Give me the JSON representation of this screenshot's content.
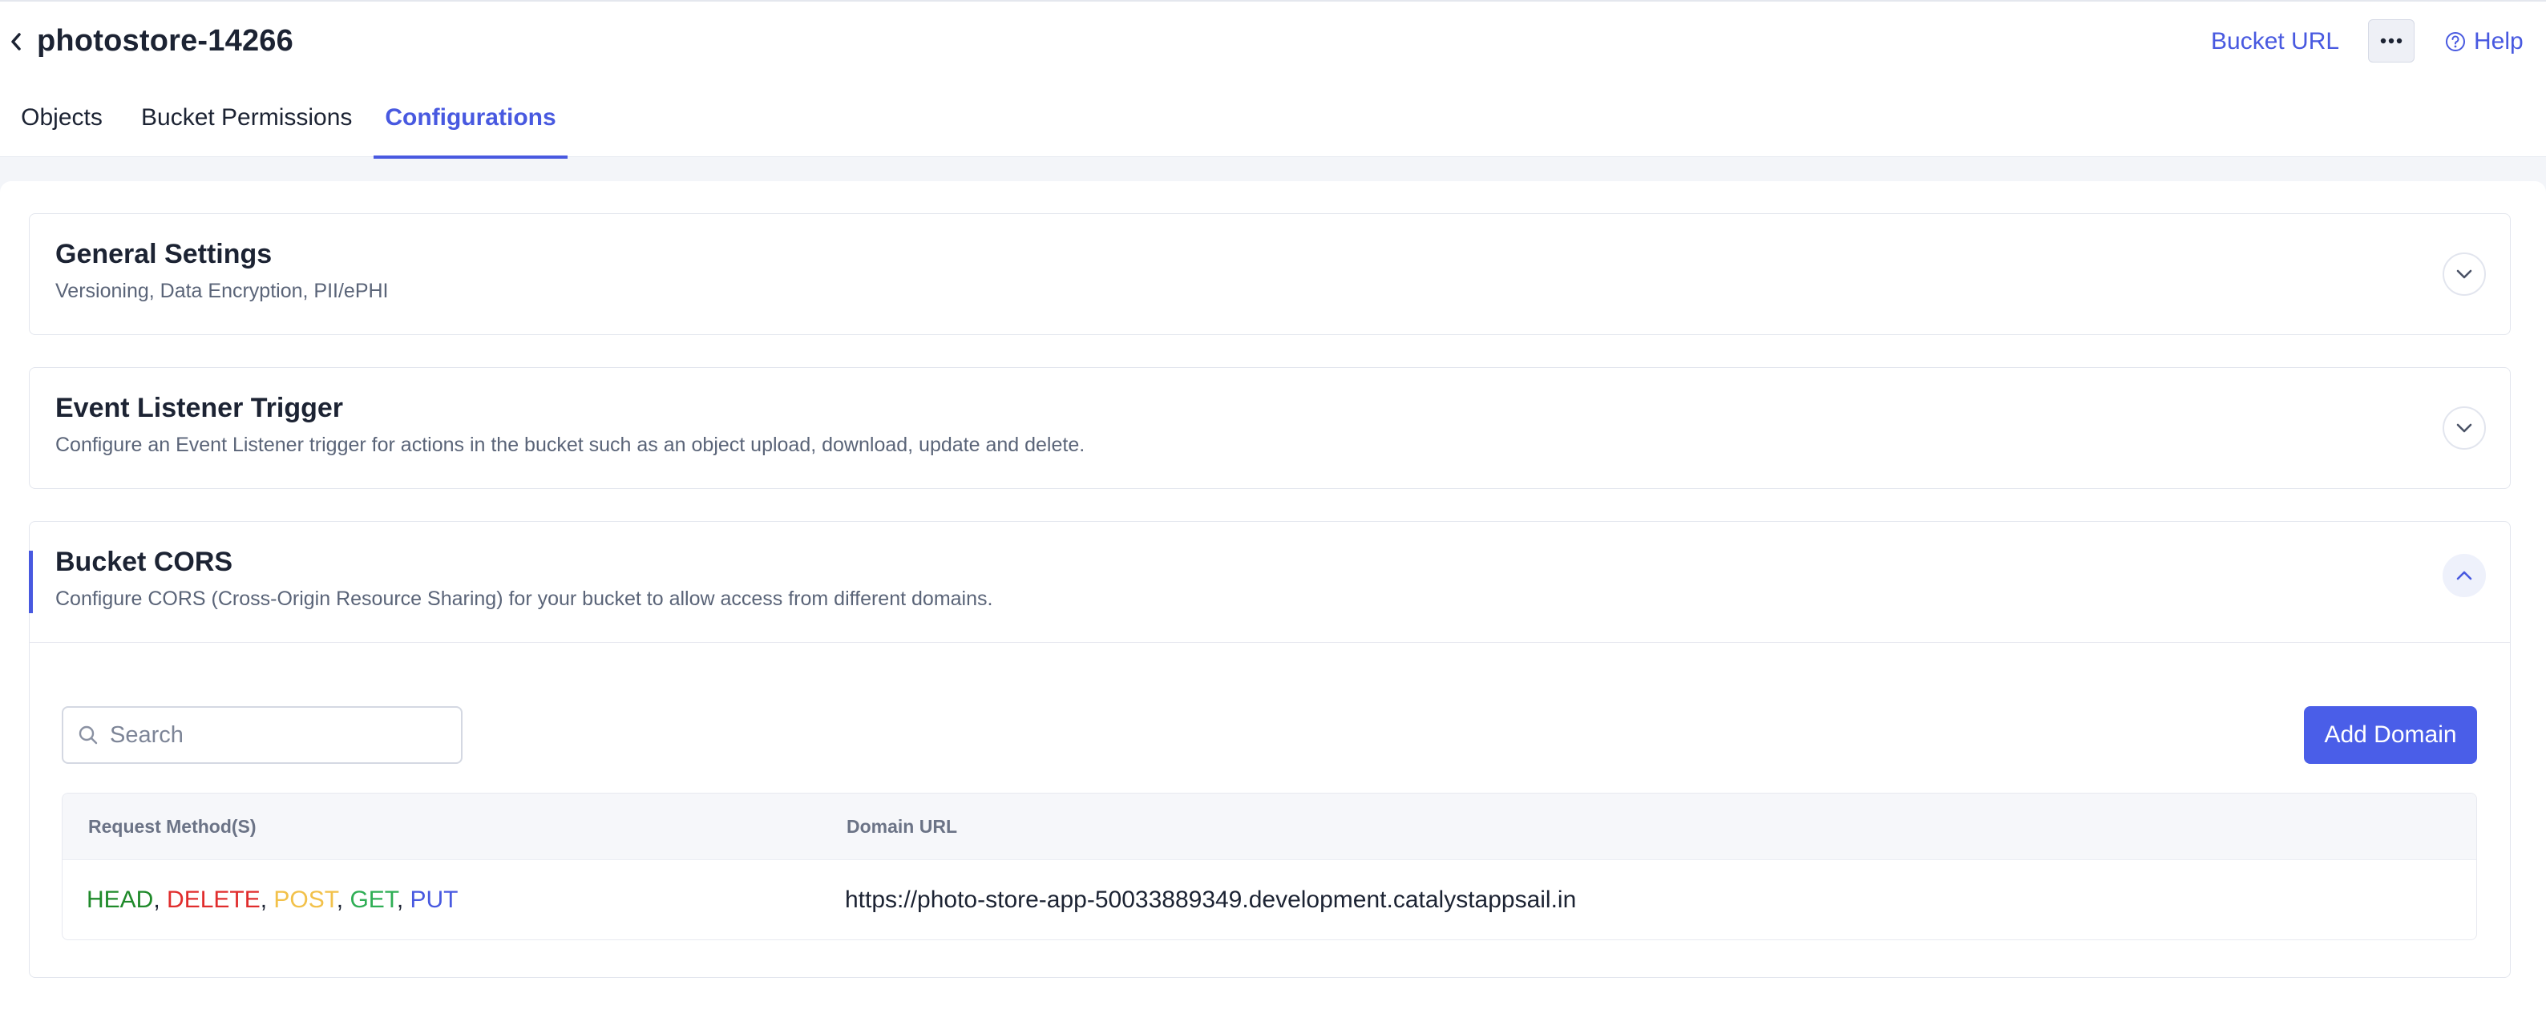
{
  "header": {
    "title": "photostore-14266",
    "bucket_url_label": "Bucket URL",
    "help_label": "Help"
  },
  "tabs": [
    {
      "label": "Objects",
      "active": false
    },
    {
      "label": "Bucket Permissions",
      "active": false
    },
    {
      "label": "Configurations",
      "active": true
    }
  ],
  "sections": [
    {
      "title": "General Settings",
      "description": "Versioning, Data Encryption, PII/ePHI",
      "expanded": false
    },
    {
      "title": "Event Listener Trigger",
      "description": "Configure an Event Listener trigger for actions in the bucket such as an object upload, download, update and delete.",
      "expanded": false
    },
    {
      "title": "Bucket CORS",
      "description": "Configure CORS (Cross-Origin Resource Sharing) for your bucket to allow access from different domains.",
      "expanded": true
    }
  ],
  "cors": {
    "search_placeholder": "Search",
    "search_value": "",
    "add_button_label": "Add Domain",
    "columns": [
      "Request Method(S)",
      "Domain URL"
    ],
    "rows": [
      {
        "methods": [
          {
            "name": "HEAD",
            "color": "#1f8a2a"
          },
          {
            "name": "DELETE",
            "color": "#e02d2d"
          },
          {
            "name": "POST",
            "color": "#f2c14a"
          },
          {
            "name": "GET",
            "color": "#2fae55"
          },
          {
            "name": "PUT",
            "color": "#4859e0"
          }
        ],
        "domain": "https://photo-store-app-50033889349.development.catalystappsail.in"
      }
    ]
  },
  "colors": {
    "accent": "#4859e0",
    "button": "#4a5ee8"
  }
}
